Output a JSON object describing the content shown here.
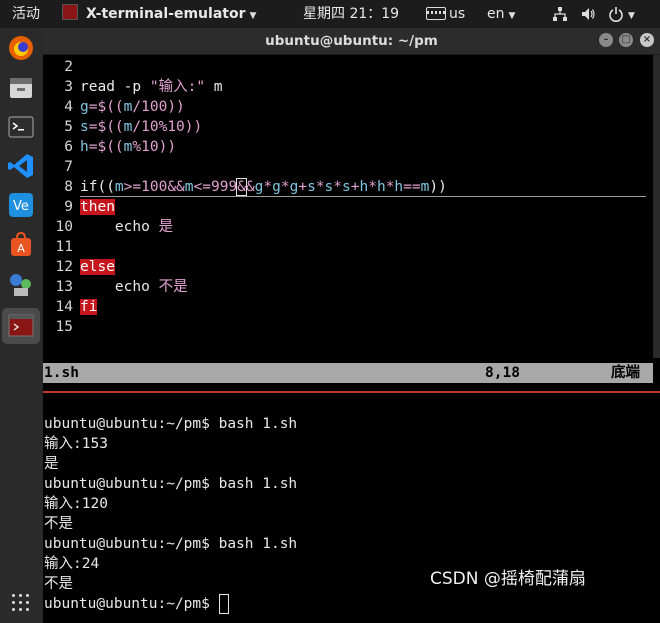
{
  "topbar": {
    "activities": "活动",
    "app_name": "X-terminal-emulator",
    "clock": "星期四 21：19",
    "keyboard": "us",
    "language": "en"
  },
  "dock": {
    "items": [
      {
        "name": "firefox-icon"
      },
      {
        "name": "files-icon"
      },
      {
        "name": "terminal-icon"
      },
      {
        "name": "vscode-icon"
      },
      {
        "name": "vscode-alt-icon"
      },
      {
        "name": "software-center-icon"
      },
      {
        "name": "network-tools-icon"
      },
      {
        "name": "x-terminal-icon"
      }
    ]
  },
  "window": {
    "title": "ubuntu@ubuntu: ~/pm"
  },
  "vim": {
    "lines": [
      {
        "n": "2",
        "code": ""
      },
      {
        "n": "3",
        "code": "read -p \"输入:\" m"
      },
      {
        "n": "4",
        "code": "g=$((m/100))"
      },
      {
        "n": "5",
        "code": "s=$((m/10%10))"
      },
      {
        "n": "6",
        "code": "h=$((m%10))"
      },
      {
        "n": "7",
        "code": ""
      },
      {
        "n": "8",
        "code": "if((m>=100&&m<=999&&g*g*g+s*s*s+h*h*h==m))"
      },
      {
        "n": "9",
        "code": "then"
      },
      {
        "n": "10",
        "code": "    echo 是"
      },
      {
        "n": "11",
        "code": ""
      },
      {
        "n": "12",
        "code": "else"
      },
      {
        "n": "13",
        "code": "    echo 不是"
      },
      {
        "n": "14",
        "code": "fi"
      },
      {
        "n": "15",
        "code": ""
      }
    ],
    "status_file": "1.sh",
    "status_pos": "8,18",
    "status_scroll": "底端"
  },
  "shell": {
    "lines": [
      "ubuntu@ubuntu:~/pm$ bash 1.sh",
      "输入:153",
      "是",
      "ubuntu@ubuntu:~/pm$ bash 1.sh",
      "输入:120",
      "不是",
      "ubuntu@ubuntu:~/pm$ bash 1.sh",
      "输入:24",
      "不是",
      "ubuntu@ubuntu:~/pm$ "
    ]
  },
  "watermark": "CSDN @摇椅配蒲扇"
}
